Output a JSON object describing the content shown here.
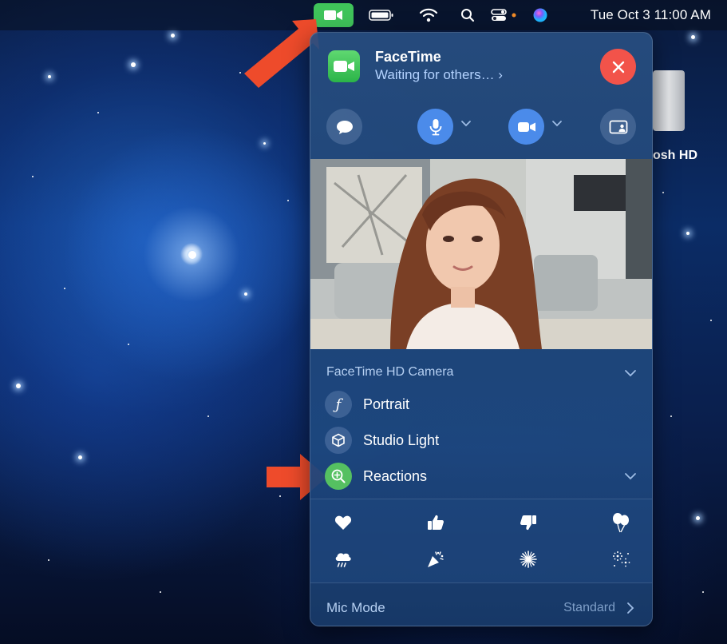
{
  "menubar": {
    "items": [
      "facetime-active-icon",
      "battery-icon",
      "wifi-icon",
      "spotlight-icon",
      "control-center-icon",
      "siri-icon"
    ],
    "clock": "Tue Oct 3  11:00 AM"
  },
  "desktop": {
    "disk_label": "osh HD"
  },
  "facetime": {
    "title": "FaceTime",
    "status": "Waiting for others… ›",
    "controls": [
      "messages-icon",
      "microphone-icon",
      "camera-icon",
      "screen-share-icon"
    ],
    "camera_section_label": "FaceTime HD Camera",
    "effects": [
      {
        "label": "Portrait",
        "icon": "portrait-icon"
      },
      {
        "label": "Studio Light",
        "icon": "studio-light-icon"
      },
      {
        "label": "Reactions",
        "icon": "reactions-icon",
        "enabled": true
      }
    ],
    "reactions": [
      "heart-icon",
      "thumbs-up-icon",
      "thumbs-down-icon",
      "balloons-icon",
      "rain-icon",
      "confetti-icon",
      "fireworks-icon",
      "laser-show-icon"
    ],
    "mic_mode_label": "Mic Mode",
    "mic_mode_value": "Standard"
  },
  "colors": {
    "accent_green": "#3fc35a",
    "close_red": "#f2534a",
    "control_blue": "#4b8bea",
    "annotation_arrow": "#ee4b2b"
  }
}
